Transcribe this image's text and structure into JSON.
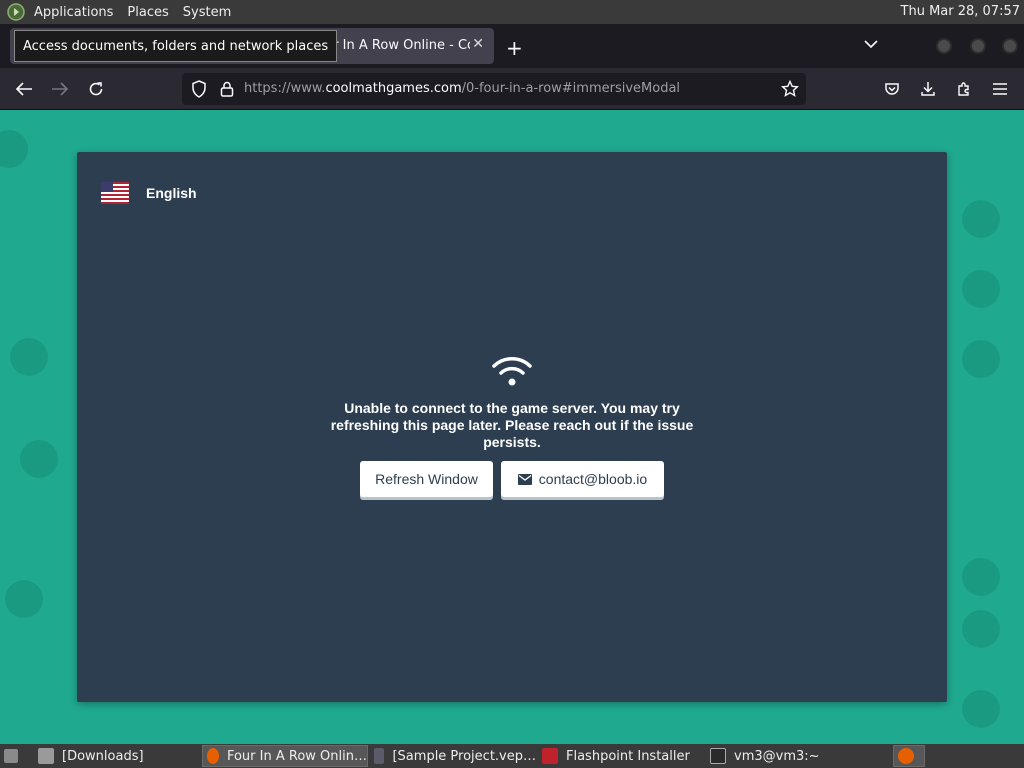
{
  "top_panel": {
    "menu": [
      "Applications",
      "Places",
      "System"
    ],
    "clock": "Thu Mar 28, 07:57"
  },
  "tooltip": "Access documents, folders and network places",
  "browser": {
    "tab_title": "Four In A Row Online - Coolmath Games",
    "url_prefix": "https://www.",
    "url_host": "coolmathgames.com",
    "url_path": "/0-four-in-a-row#immersiveModal"
  },
  "modal": {
    "language": "English",
    "error_message": "Unable to connect to the game server. You may try refreshing this page later. Please reach out if the issue persists.",
    "refresh_label": "Refresh Window",
    "contact_label": "contact@bloob.io"
  },
  "taskbar": {
    "items": [
      "[Downloads]",
      "Four In A Row Onlin…",
      "[Sample Project.vep…",
      "Flashpoint Installer",
      "vm3@vm3:~"
    ]
  },
  "colors": {
    "page_bg": "#1fa98f",
    "modal_bg": "#2d3e50",
    "panel_bg": "#3a3a3a"
  }
}
